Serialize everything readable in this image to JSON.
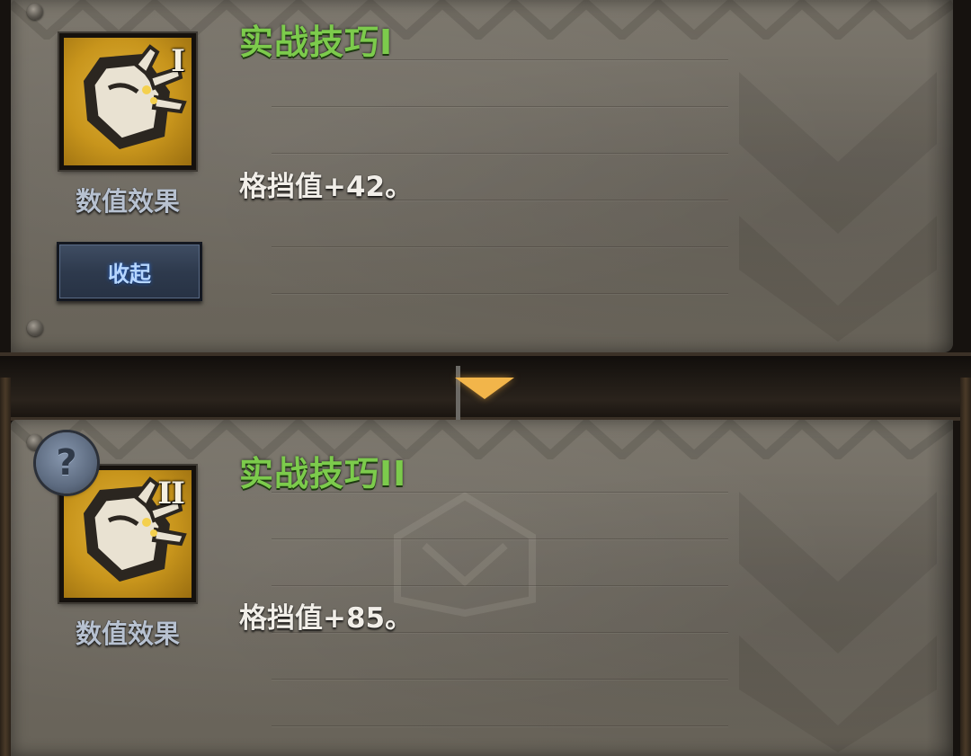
{
  "skills": [
    {
      "title": "实战技巧I",
      "rank": "I",
      "effect_label": "数值效果",
      "description": "格挡值+42。",
      "icon": "shield-icon"
    },
    {
      "title": "实战技巧II",
      "rank": "II",
      "effect_label": "数值效果",
      "description": "格挡值+85。",
      "icon": "shield-icon"
    }
  ],
  "collapse_button": {
    "label": "收起"
  },
  "help_button": {
    "label": "?",
    "icon": "question-icon"
  },
  "divider_arrow": {
    "icon": "arrow-down-icon"
  },
  "colors": {
    "title_green": "#7ccb4c",
    "description_text": "#f1eee8",
    "effect_label": "#b7c1d0",
    "icon_gold": "#c8951c",
    "button_text": "#b6d6ff",
    "arrow": "#f2b54a"
  }
}
